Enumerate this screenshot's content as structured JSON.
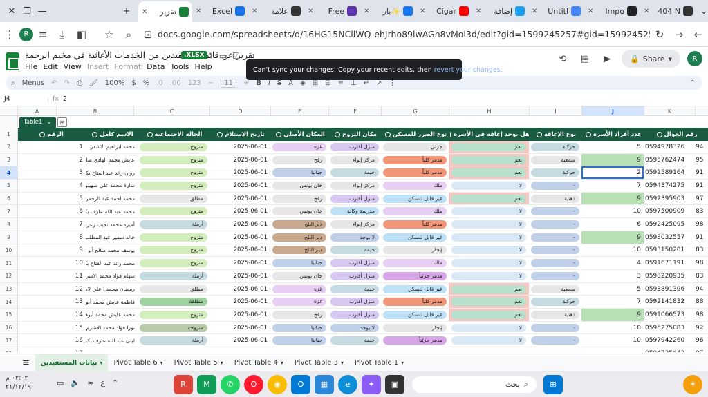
{
  "browser": {
    "tabs": [
      {
        "label": "تقرير",
        "icon_color": "#188038",
        "active": true
      },
      {
        "label": "Excel",
        "icon_color": "#1a73e8"
      },
      {
        "label": "علامة",
        "icon_color": "#333333"
      },
      {
        "label": "Free",
        "icon_color": "#5e35b1"
      },
      {
        "label": "بار✨",
        "icon_color": "#1877f2"
      },
      {
        "label": "Cigar",
        "icon_color": "#ff0000"
      },
      {
        "label": "إضافة",
        "icon_color": "#1da1f2"
      },
      {
        "label": "Untitl",
        "icon_color": "#4285f4"
      },
      {
        "label": "Impo",
        "icon_color": "#222222"
      },
      {
        "label": "404 N",
        "icon_color": "#333333"
      }
    ],
    "url": "docs.google.com/spreadsheets/d/16HG15NCilWQ-ehJrho89lwAGh8vMol3d/edit?gid=1599245257#gid=1599245257",
    "profile_initial": "R"
  },
  "doc": {
    "title": "تقرير عن قائمة مستفيدين من الخدمات الأغاثية في مخيم الرحمة",
    "badge": ".XLSX",
    "menus": [
      "File",
      "Edit",
      "View",
      "Insert",
      "Format",
      "Data",
      "Tools",
      "Help"
    ],
    "share_label": "Share",
    "toast_text": "Can't sync your changes. Copy your recent edits, then",
    "toast_link": "revert your changes."
  },
  "toolbar": {
    "menus": "Menus",
    "zoom": "100%",
    "currency": "$",
    "percent": "%",
    "font_size": "11"
  },
  "formula": {
    "cell_ref": "J4",
    "value": "2"
  },
  "columns": [
    "A",
    "B",
    "C",
    "D",
    "E",
    "F",
    "G",
    "H",
    "I",
    "J",
    "K"
  ],
  "table_name": "Table1",
  "headers": {
    "num": "الرقم",
    "name": "الاسم كامل",
    "social": "الحالة الاجتماعية",
    "date": "تاريخ الاستلام",
    "origin": "المكان الأصلي",
    "place": "مكان النزوح",
    "shelter": "نوع الضرر للمسكن",
    "disability": "هل يوجد إعاقة في الأسرة",
    "distype": "نوع الإعاقة",
    "members": "عدد أفراد الأسرة",
    "phone": "رقم الجوال"
  },
  "rows": [
    {
      "r": "2",
      "num": "1",
      "name": "محمد ابراهيم الاشقر",
      "social": "متزوج",
      "date": "2025-06-01",
      "origin": "غزة",
      "place": "منزل أقارب",
      "shelter": "جزئي",
      "dis": "نعم",
      "distype": "حركية",
      "members": "5",
      "phone": "0594978326",
      "k": "94"
    },
    {
      "r": "3",
      "num": "2",
      "name": "عايش محمد الهادي صالح",
      "social": "متزوج",
      "date": "2025-06-01",
      "origin": "رفح",
      "place": "مركز إيواء",
      "shelter": "مدمر كلياً",
      "dis": "نعم",
      "distype": "سمعية",
      "members": "9",
      "phone": "0595762474",
      "k": "95"
    },
    {
      "r": "4",
      "num": "3",
      "name": "روان رائد عبد الفتاح بكر",
      "social": "متزوج",
      "date": "2025-06-01",
      "origin": "جباليا",
      "place": "خيمة",
      "shelter": "مدمر كلياً",
      "dis": "نعم",
      "distype": "حركية",
      "members": "2",
      "phone": "0592589164",
      "k": "91"
    },
    {
      "r": "5",
      "num": "4",
      "name": "سارة محمد علي صهيبون",
      "social": "متزوج",
      "date": "2025-06-01",
      "origin": "خان يونس",
      "place": "مركز إيواء",
      "shelter": "ملك",
      "dis": "لا",
      "distype": "-",
      "members": "7",
      "phone": "0594374275",
      "k": "91"
    },
    {
      "r": "6",
      "num": "5",
      "name": "محمد احمد عبد الرحمن دبور",
      "social": "مطلق",
      "date": "2025-06-01",
      "origin": "رفح",
      "place": "منزل أقارب",
      "shelter": "غير قابل للسكن",
      "dis": "نعم",
      "distype": "ذهنية",
      "members": "9",
      "phone": "0592395903",
      "k": "97"
    },
    {
      "r": "7",
      "num": "6",
      "name": "محمد عبد الله عارف بكر",
      "social": "متزوج",
      "date": "2025-06-01",
      "origin": "خان يونس",
      "place": "مدرسة وكالة",
      "shelter": "ملك",
      "dis": "لا",
      "distype": "-",
      "members": "10",
      "phone": "0597500909",
      "k": "83"
    },
    {
      "r": "8",
      "num": "7",
      "name": "أميرة محمد نجيب زعرة",
      "social": "أرملة",
      "date": "2025-06-01",
      "origin": "دير البلح",
      "place": "مركز إيواء",
      "shelter": "مدمر كلياً",
      "dis": "لا",
      "distype": "-",
      "members": "6",
      "phone": "0592425095",
      "k": "98"
    },
    {
      "r": "9",
      "num": "8",
      "name": "خالد سمير عبد المطلب زعرة",
      "social": "متزوج",
      "date": "2025-06-01",
      "origin": "دير البلح",
      "place": "لا يوجد",
      "shelter": "غير قابل للسكن",
      "dis": "لا",
      "distype": "-",
      "members": "9",
      "phone": "0593032557",
      "k": "91"
    },
    {
      "r": "10",
      "num": "9",
      "name": "يوسف محمد صالح أبو وطفة",
      "social": "متزوج",
      "date": "2025-06-01",
      "origin": "دير البلح",
      "place": "خيمة",
      "shelter": "إيجار",
      "dis": "لا",
      "distype": "-",
      "members": "10",
      "phone": "0593150201",
      "k": "83"
    },
    {
      "r": "11",
      "num": "10",
      "name": "محمد رائد عبد الفتاح بكر",
      "social": "متزوج",
      "date": "2025-06-01",
      "origin": "جباليا",
      "place": "منزل أقارب",
      "shelter": "ملك",
      "dis": "لا",
      "distype": "-",
      "members": "4",
      "phone": "0591671191",
      "k": "98"
    },
    {
      "r": "12",
      "num": "11",
      "name": "سهام فؤاد محمد الاشرم",
      "social": "أرملة",
      "date": "2025-06-01",
      "origin": "خان يونس",
      "place": "منزل أقارب",
      "shelter": "مدمر جزئياً",
      "dis": "لا",
      "distype": "-",
      "members": "3",
      "phone": "0598220935",
      "k": "83"
    },
    {
      "r": "13",
      "num": "12",
      "name": "رمضان محمد ا علي لاشرم",
      "social": "مطلق",
      "date": "2025-06-01",
      "origin": "غزة",
      "place": "خيمة",
      "shelter": "غير قابل للسكن",
      "dis": "نعم",
      "distype": "سمعية",
      "members": "5",
      "phone": "0593891396",
      "k": "94"
    },
    {
      "r": "14",
      "num": "13",
      "name": "فاطمة عايش محمد أبوهربيد",
      "social": "مطلقة",
      "date": "2025-06-01",
      "origin": "غزة",
      "place": "منزل أقارب",
      "shelter": "مدمر كلياً",
      "dis": "نعم",
      "distype": "حركية",
      "members": "7",
      "phone": "0592141832",
      "k": "88"
    },
    {
      "r": "15",
      "num": "14",
      "name": "محمد عايش محمد أبوهربيد",
      "social": "متزوج",
      "date": "2025-06-01",
      "origin": "رفح",
      "place": "منزل أقارب",
      "shelter": "غير قابل للسكن",
      "dis": "نعم",
      "distype": "ذهنية",
      "members": "9",
      "phone": "0591066573",
      "k": "98"
    },
    {
      "r": "16",
      "num": "15",
      "name": "نورا فؤاد محمد الاشرم",
      "social": "متزوجة",
      "date": "2025-06-01",
      "origin": "جباليا",
      "place": "لا يوجد",
      "shelter": "إيجار",
      "dis": "لا",
      "distype": "-",
      "members": "10",
      "phone": "0595275083",
      "k": "92"
    },
    {
      "r": "17",
      "num": "16",
      "name": "ليلى عبد الله عارف بكر",
      "social": "أرملة",
      "date": "2025-06-01",
      "origin": "جباليا",
      "place": "خيمة",
      "shelter": "مدمر جزئياً",
      "dis": "لا",
      "distype": "-",
      "members": "10",
      "phone": "0597942260",
      "k": "96"
    },
    {
      "r": "18",
      "num": "17",
      "name": "",
      "social": "",
      "date": "",
      "origin": "",
      "place": "",
      "shelter": "",
      "dis": "",
      "distype": "",
      "members": "",
      "phone": "0594735643",
      "k": "97"
    }
  ],
  "sheet_tabs": [
    "بيانات المستفيدين",
    "Pivot Table 6",
    "Pivot Table 5",
    "Pivot Table 4",
    "Pivot Table 3",
    "Pivot Table 1"
  ],
  "taskbar": {
    "search": "بحث",
    "time": "٠٢:٠٢ م",
    "date": "٢١/١٢/١٩",
    "lang": "ع"
  }
}
